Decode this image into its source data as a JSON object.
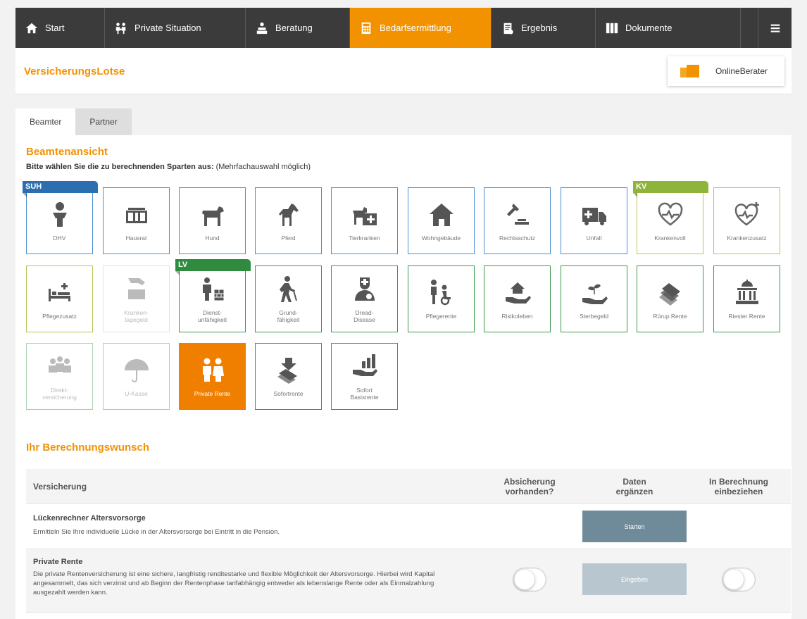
{
  "nav": {
    "items": [
      {
        "label": "Start",
        "icon": "home-icon"
      },
      {
        "label": "Private Situation",
        "icon": "family-icon"
      },
      {
        "label": "Beratung",
        "icon": "consult-icon"
      },
      {
        "label": "Bedarfsermittlung",
        "icon": "calculator-icon"
      },
      {
        "label": "Ergebnis",
        "icon": "clipboard-icon"
      },
      {
        "label": "Dokumente",
        "icon": "binders-icon"
      }
    ],
    "menu_icon": "hamburger-icon"
  },
  "header": {
    "brand": "VersicherungsLotse",
    "online_button": "OnlineBerater"
  },
  "tabs": [
    "Beamter",
    "Partner"
  ],
  "section": {
    "title": "Beamtenansicht",
    "instruction_bold": "Bitte wählen Sie die zu berechnenden Sparten aus:",
    "instruction_note": "(Mehrfachauswahl möglich)"
  },
  "badges": {
    "suh": "SUH",
    "kv": "KV",
    "lv": "LV"
  },
  "tiles": [
    {
      "label": "DHV",
      "icon": "person-icon"
    },
    {
      "label": "Hausrat",
      "icon": "furniture-icon"
    },
    {
      "label": "Hund",
      "icon": "dog-icon"
    },
    {
      "label": "Pferd",
      "icon": "horse-icon"
    },
    {
      "label": "Tierkranken",
      "icon": "pet-medical-icon"
    },
    {
      "label": "Wohngebäude",
      "icon": "house-icon"
    },
    {
      "label": "Rechtsschutz",
      "icon": "gavel-icon"
    },
    {
      "label": "Unfall",
      "icon": "ambulance-icon"
    },
    {
      "label": "Krankenvoll",
      "icon": "heart-icon"
    },
    {
      "label": "Krankenzusatz",
      "icon": "heart-plus-icon"
    },
    {
      "label": "Pflegezusatz",
      "icon": "bed-icon"
    },
    {
      "label": "Kranken-\ntagegeld",
      "icon": "money-hand-icon"
    },
    {
      "label": "Dienst-\nunfähigkeit",
      "icon": "worker-icon"
    },
    {
      "label": "Grund-\nfähigkeit",
      "icon": "walking-icon"
    },
    {
      "label": "Dread-\nDisease",
      "icon": "doctor-icon"
    },
    {
      "label": "Pflegerente",
      "icon": "wheelchair-icon"
    },
    {
      "label": "Risikoleben",
      "icon": "hand-house-icon"
    },
    {
      "label": "Sterbegeld",
      "icon": "hand-plant-icon"
    },
    {
      "label": "Rürup Rente",
      "icon": "money-stack-icon"
    },
    {
      "label": "Riester Rente",
      "icon": "government-building-icon"
    },
    {
      "label": "Direkt-\nversicherung",
      "icon": "group-icon"
    },
    {
      "label": "U-Kasse",
      "icon": "umbrella-icon"
    },
    {
      "label": "Private Rente",
      "icon": "elderly-couple-icon"
    },
    {
      "label": "Sofortrente",
      "icon": "money-down-icon"
    },
    {
      "label": "Sofort\nBasisrente",
      "icon": "bar-chart-hand-icon"
    }
  ],
  "calc_section": {
    "title": "Ihr Berechnungswunsch",
    "headers": [
      "Versicherung",
      "Absicherung\nvorhanden?",
      "Daten\nergänzen",
      "In Berechnung\neinbeziehen"
    ],
    "rows": [
      {
        "title": "Lückenrechner Altersvorsorge",
        "desc": "Ermitteln Sie Ihre individuelle Lücke in der Altersvorsorge bei Eintritt in die Pension.",
        "button": "Starten"
      },
      {
        "title": "Private Rente",
        "desc": "Die private Rentenversicherung ist eine sichere, langfristig renditestarke und flexible Möglichkeit der Altersvorsorge. Hierbei wird Kapital angesammelt, das sich verzinst und ab Beginn der Rentenphase tarifabhängig entweder als lebenslange Rente oder als Einmalzahlung ausgezahlt werden kann.",
        "button": "Eingeben"
      }
    ]
  },
  "colors": {
    "accent": "#f39200",
    "suh": "#2b6fb0",
    "kv": "#8eb43a",
    "lv": "#2f8c3f",
    "nav": "#3b3b3b"
  }
}
